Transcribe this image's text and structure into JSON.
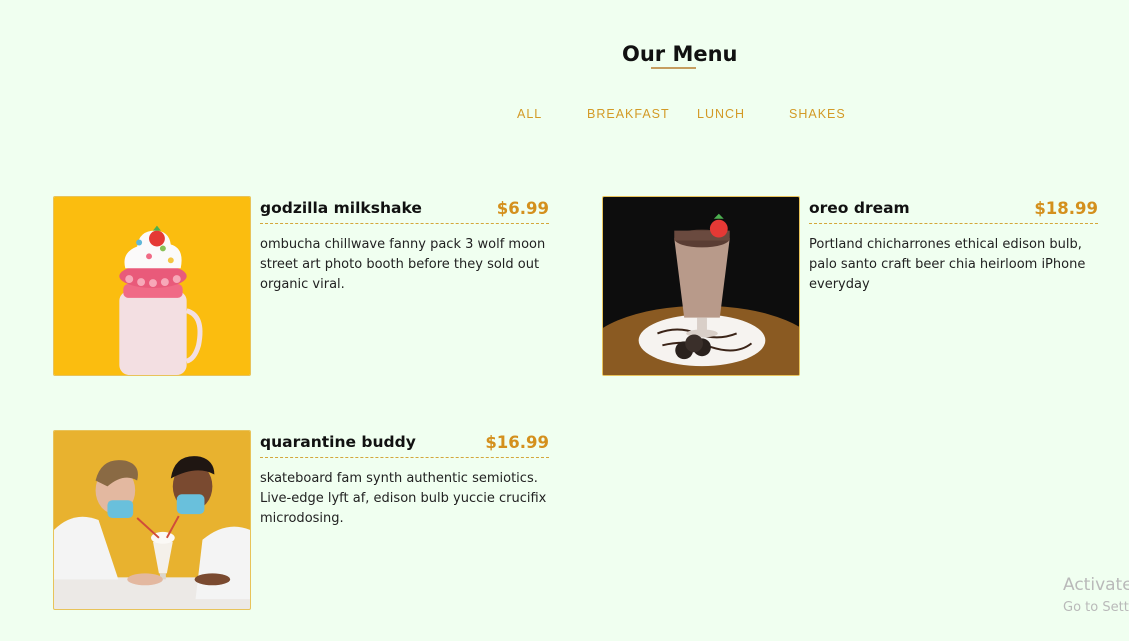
{
  "page": {
    "title": "Our Menu"
  },
  "filters": [
    "all",
    "breakfast",
    "lunch",
    "shakes"
  ],
  "items": [
    {
      "name": "godzilla milkshake",
      "price": "$6.99",
      "desc": "ombucha chillwave fanny pack 3 wolf moon street art photo booth before they sold out organic viral.",
      "image": "milkshake-photo"
    },
    {
      "name": "oreo dream",
      "price": "$18.99",
      "desc": "Portland chicharrones ethical edison bulb, palo santo craft beer chia heirloom iPhone everyday",
      "image": "oreo-shake-photo"
    },
    {
      "name": "quarantine buddy",
      "price": "$16.99",
      "desc": "skateboard fam synth authentic semiotics. Live-edge lyft af, edison bulb yuccie crucifix microdosing.",
      "image": "couple-sharing-shake-photo"
    }
  ],
  "watermark": {
    "line1": "Activate",
    "line2": "Go to Sett"
  },
  "colors": {
    "background": "#f0fff0",
    "accent": "#d4901d",
    "underline": "#c59d5f"
  }
}
